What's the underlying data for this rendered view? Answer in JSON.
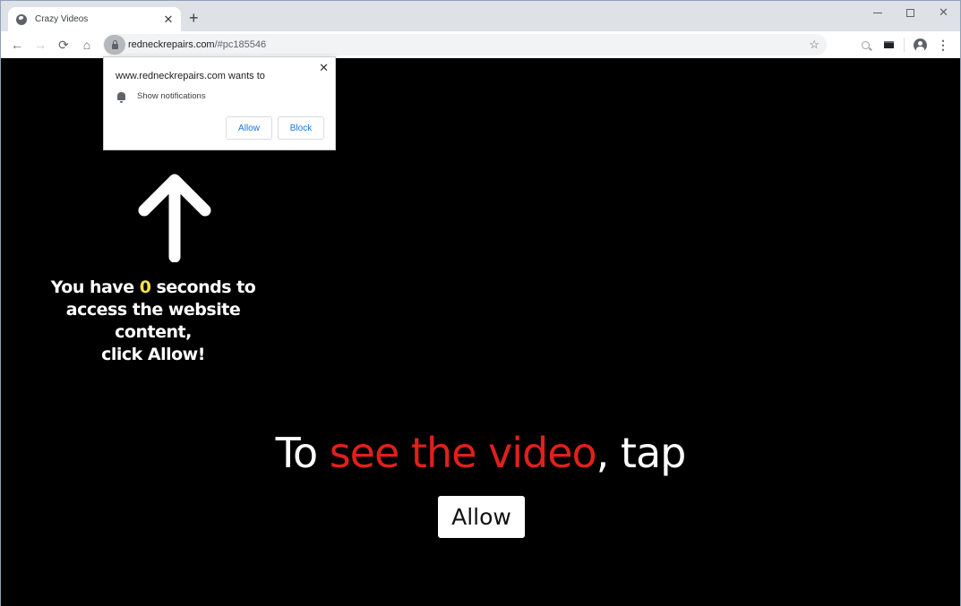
{
  "browser": {
    "tab": {
      "title": "Crazy Videos",
      "favicon": "globe-icon",
      "close": "✕"
    },
    "new_tab": "+",
    "window_controls": {
      "minimize": "minimize-icon",
      "maximize": "maximize-icon",
      "close": "✕"
    },
    "nav": {
      "back": "←",
      "forward": "→",
      "reload": "⟳",
      "home": "⌂"
    },
    "address": {
      "domain": "redneckrepairs.com",
      "path": "/#pc185546"
    },
    "bookmark": "☆",
    "menu": "⋮"
  },
  "notification_popup": {
    "title": "www.redneckrepairs.com wants to",
    "permission": "Show notifications",
    "allow_label": "Allow",
    "block_label": "Block",
    "close": "✕"
  },
  "page": {
    "countdown": {
      "prefix": "You have ",
      "seconds": "0",
      "suffix": " seconds to",
      "line2": "access the website content,",
      "line3": "click Allow!"
    },
    "headline": {
      "part1": "To ",
      "highlight": "see the video",
      "part2": ", tap"
    },
    "allow_button": "Allow",
    "colors": {
      "highlight": "#e0201c",
      "countdown_number": "#f4e04d",
      "background": "#000000"
    }
  }
}
